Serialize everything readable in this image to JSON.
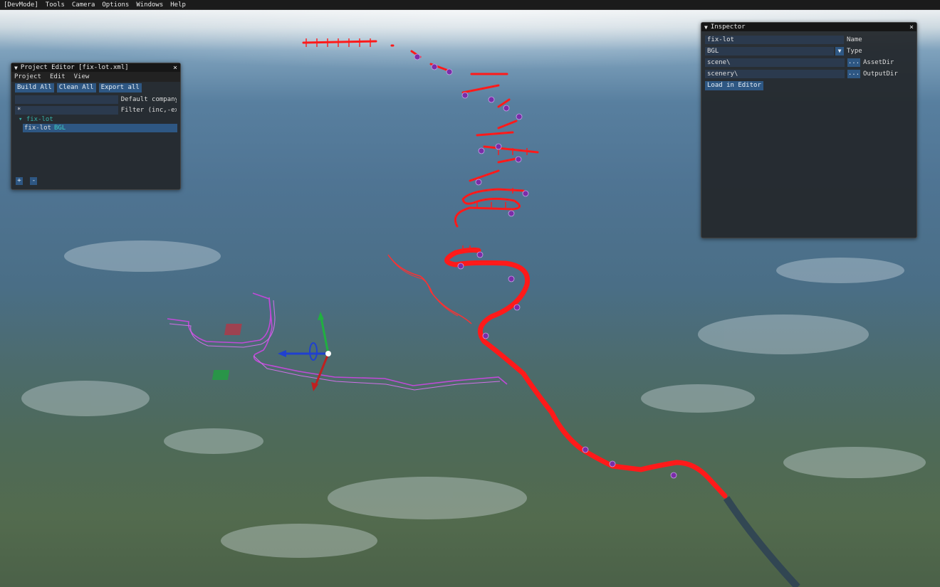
{
  "menubar": {
    "items": [
      "[DevMode]",
      "Tools",
      "Camera",
      "Options",
      "Windows",
      "Help"
    ]
  },
  "project_editor": {
    "title": "Project Editor [fix-lot.xml]",
    "close_glyph": "×",
    "menu": [
      "Project",
      "Edit",
      "View"
    ],
    "buttons": {
      "build_all": "Build All",
      "clean_all": "Clean All",
      "export_all": "Export all"
    },
    "company_label": "Default company",
    "company_value": "",
    "filter_value": "*",
    "filter_label": "Filter (inc,-ex",
    "tree": {
      "parent": "▾ fix-lot",
      "child_name": "fix-lot",
      "child_type": "BGL"
    },
    "add_button": "+",
    "remove_button": "-"
  },
  "inspector": {
    "title": "Inspector",
    "close_glyph": "×",
    "name_value": "fix-lot",
    "name_label": "Name",
    "type_value": "BGL",
    "type_label": "Type",
    "asset_dir_value": "scene\\",
    "asset_dir_label": "AssetDir",
    "output_dir_value": "scenery\\",
    "output_dir_label": "OutputDir",
    "browse_label": "...",
    "load_button": "Load in Editor"
  },
  "icons": [
    "collapse-triangle-icon",
    "close-icon",
    "dropdown-arrow-icon",
    "translate-gizmo-icon"
  ],
  "colors": {
    "accent": "#2e5783",
    "path_red": "#ff1a1a",
    "path_magenta": "#c04ad8",
    "waypoint_purple": "#7a2da8",
    "gizmo_x": "#d42020",
    "gizmo_y": "#20b040",
    "gizmo_z": "#2040d0"
  }
}
